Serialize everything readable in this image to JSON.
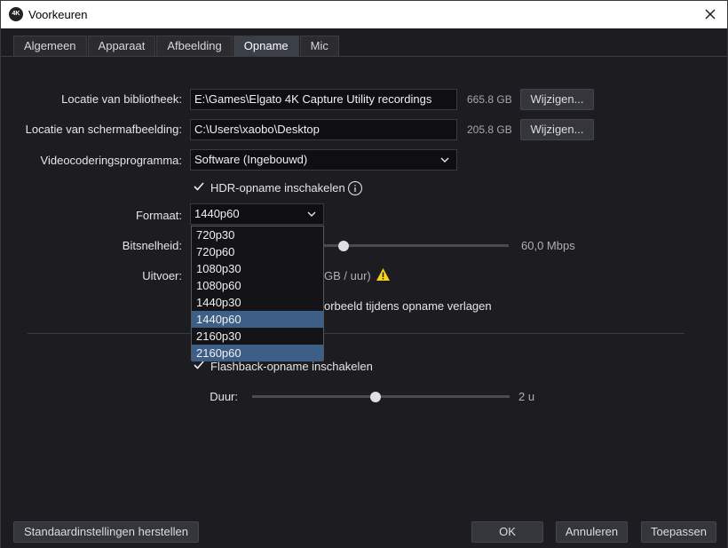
{
  "window": {
    "title": "Voorkeuren",
    "app_icon_text": "4K"
  },
  "tabs": [
    {
      "label": "Algemeen"
    },
    {
      "label": "Apparaat"
    },
    {
      "label": "Afbeelding"
    },
    {
      "label": "Opname"
    },
    {
      "label": "Mic"
    }
  ],
  "library": {
    "label": "Locatie van bibliotheek:",
    "value": "E:\\Games\\Elgato 4K Capture Utility recordings",
    "size": "665.8 GB",
    "button": "Wijzigen..."
  },
  "screenshot": {
    "label": "Locatie van schermafbeelding:",
    "value": "C:\\Users\\xaobo\\Desktop",
    "size": "205.8 GB",
    "button": "Wijzigen..."
  },
  "encoder": {
    "label": "Videocoderingsprogramma:",
    "value": "Software (Ingebouwd)"
  },
  "hdr": {
    "label": "HDR-opname inschakelen",
    "checked": true
  },
  "format": {
    "label": "Formaat:",
    "value": "1440p60",
    "options": [
      "720p30",
      "720p60",
      "1080p30",
      "1080p60",
      "1440p30",
      "1440p60",
      "2160p30",
      "2160p60"
    ],
    "selected_index": 5,
    "hover_index": 7
  },
  "bitrate": {
    "label": "Bitsnelheid:",
    "value": "60,0 Mbps",
    "level": 0.5
  },
  "output": {
    "label": "Uitvoer:",
    "value_suffix": "GB / uur)"
  },
  "preview": {
    "label_suffix": "orbeeld tijdens opname verlagen"
  },
  "flashback": {
    "label": "Flashback-opname inschakelen",
    "checked": true
  },
  "duration": {
    "label": "Duur:",
    "value": "2 u",
    "level": 0.48
  },
  "footer": {
    "reset": "Standaardinstellingen herstellen",
    "ok": "OK",
    "cancel": "Annuleren",
    "apply": "Toepassen"
  },
  "colors": {
    "accent": "#3d5e86",
    "warning": "#f2d21b"
  }
}
